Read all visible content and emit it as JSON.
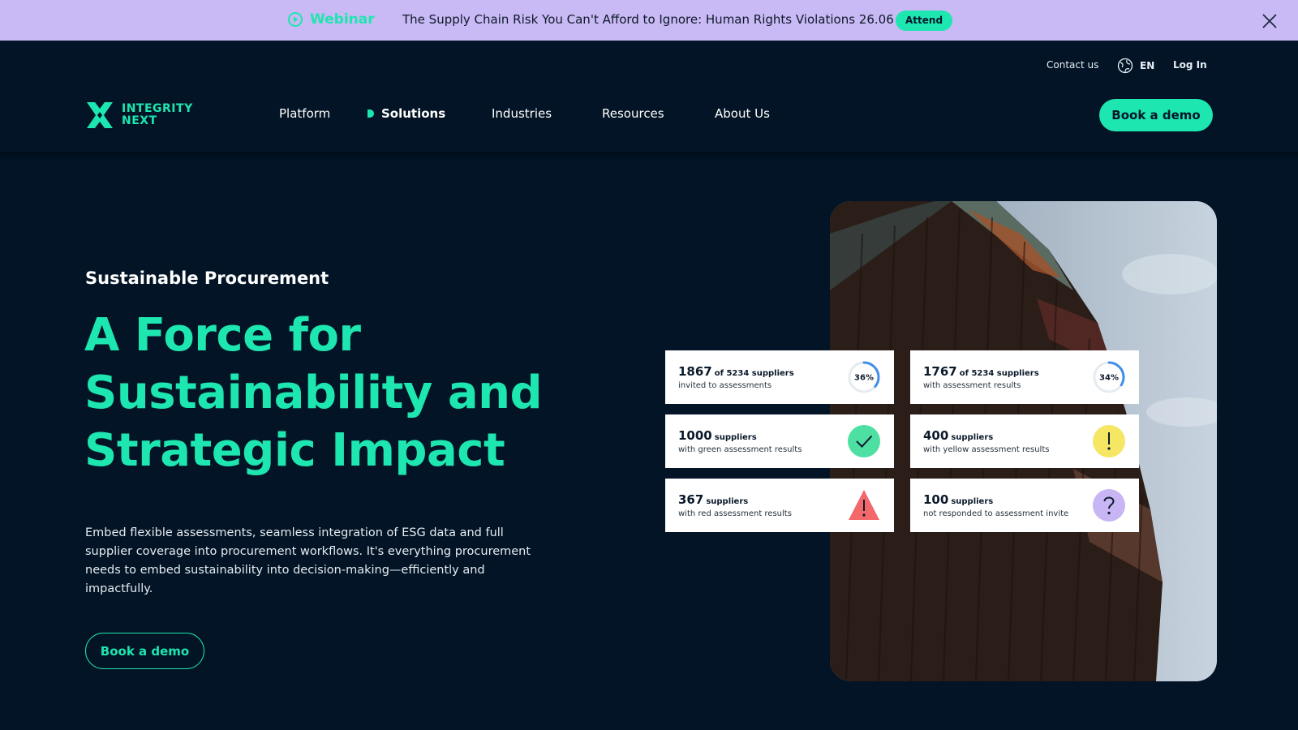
{
  "banner": {
    "tag": "Webinar",
    "message": "The Supply Chain Risk You Can't Afford to Ignore: Human Rights Violations 26.06",
    "attend_label": "Attend"
  },
  "utility_nav": {
    "contact": "Contact us",
    "language": "EN",
    "login": "Log In"
  },
  "brand": {
    "line1": "INTEGRITY",
    "line2": "NEXT"
  },
  "nav": {
    "items": [
      {
        "label": "Platform"
      },
      {
        "label": "Solutions",
        "active": true
      },
      {
        "label": "Industries"
      },
      {
        "label": "Resources"
      },
      {
        "label": "About Us"
      }
    ],
    "cta": "Book a demo"
  },
  "hero": {
    "eyebrow": "Sustainable Procurement",
    "headline_lines": [
      "A Force for",
      "Sustainability and",
      "Strategic Impact"
    ],
    "body": "Embed flexible assessments, seamless integration of ESG data and full supplier coverage into procurement workflows. It's everything procurement needs to embed sustainability into decision-making—efficiently and impactfully.",
    "cta": "Book a demo"
  },
  "stats": [
    {
      "value": "1867",
      "unit": "of 5234 suppliers",
      "desc": "invited to assessments",
      "icon": "progress-ring",
      "percent_label": "36%",
      "percent": 36,
      "color": "#3f8ee8"
    },
    {
      "value": "1767",
      "unit": "of 5234 suppliers",
      "desc": "with assessment results",
      "icon": "progress-ring",
      "percent_label": "34%",
      "percent": 34,
      "color": "#3f8ee8"
    },
    {
      "value": "1000",
      "unit": "suppliers",
      "desc": "with green assessment results",
      "icon": "check-icon",
      "color": "#4ee0a3"
    },
    {
      "value": "400",
      "unit": "suppliers",
      "desc": "with yellow assessment results",
      "icon": "exclamation-icon",
      "color": "#f5e663"
    },
    {
      "value": "367",
      "unit": "suppliers",
      "desc": "with red assessment results",
      "icon": "warning-triangle-icon",
      "color": "#f2686b"
    },
    {
      "value": "100",
      "unit": "suppliers",
      "desc": "not responded to assessment invite",
      "icon": "question-icon",
      "color": "#c8b5f3"
    }
  ],
  "colors": {
    "accent": "#1ee6b0",
    "background": "#021425",
    "banner": "#c9b9f4"
  }
}
